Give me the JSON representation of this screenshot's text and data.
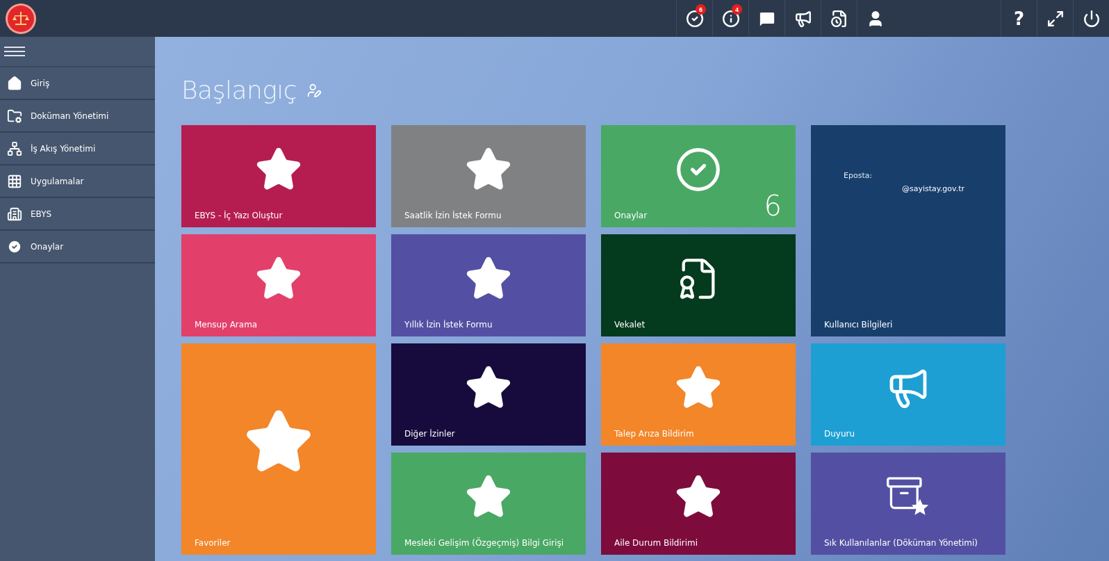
{
  "topbar": {
    "actions": [
      {
        "kind": "check",
        "badge": "6"
      },
      {
        "kind": "info",
        "badge": "4"
      },
      {
        "kind": "chat"
      },
      {
        "kind": "megaphone"
      },
      {
        "kind": "document"
      },
      {
        "kind": "user"
      }
    ],
    "help": "?",
    "tools": [
      {
        "kind": "expand"
      },
      {
        "kind": "power"
      }
    ]
  },
  "sidebar": {
    "items": [
      {
        "label": "Giriş",
        "kind": "home"
      },
      {
        "label": "Doküman Yönetimi",
        "kind": "folder"
      },
      {
        "label": "İş Akış Yönetimi",
        "kind": "workflow"
      },
      {
        "label": "Uygulamalar",
        "kind": "grid"
      },
      {
        "label": "EBYS",
        "kind": "building"
      },
      {
        "label": "Onaylar",
        "kind": "check"
      }
    ]
  },
  "page": {
    "title": "Başlangıç"
  },
  "tile_columns": [
    [
      {
        "label": "EBYS - İç Yazı Oluştur",
        "color": "#b51d51",
        "kind": "star",
        "tall": false
      },
      {
        "label": "Mensup Arama",
        "color": "#e2406a",
        "kind": "star",
        "tall": false
      },
      {
        "label": "Favoriler",
        "color": "#f28629",
        "kind": "star",
        "tall": true
      }
    ],
    [
      {
        "label": "Saatlik İzin İstek Formu",
        "color": "#7f8183",
        "kind": "star",
        "tall": false
      },
      {
        "label": "Yıllık İzin İstek Formu",
        "color": "#5350a3",
        "kind": "star",
        "tall": false
      },
      {
        "label": "Diğer İzinler",
        "color": "#170b3d",
        "kind": "star",
        "tall": false
      },
      {
        "label": "Mesleki Gelişim (Özgeçmiş) Bilgi Girişi",
        "color": "#4aa865",
        "kind": "star",
        "tall": false
      }
    ],
    [
      {
        "label": "Onaylar",
        "color": "#4aa865",
        "kind": "check",
        "tall": false,
        "count": "6"
      },
      {
        "label": "Vekalet",
        "color": "#043a1d",
        "kind": "certificate",
        "tall": false
      },
      {
        "label": "Talep Arıza Bildirim",
        "color": "#f28629",
        "kind": "star",
        "tall": false
      },
      {
        "label": "Aile Durum Bildirimi",
        "color": "#7d0c3d",
        "kind": "star",
        "tall": false
      }
    ],
    [
      {
        "label": "Kullanıcı Bilgileri",
        "color": "#183f6c",
        "kind": "info",
        "tall": true,
        "email_label": "Eposta:",
        "email": "@sayistay.gov.tr"
      },
      {
        "label": "Duyuru",
        "color": "#1d9fd3",
        "kind": "megaphone",
        "tall": false
      },
      {
        "label": "Sık Kullanılanlar (Döküman Yönetimi)",
        "color": "#5350a3",
        "kind": "box-star",
        "tall": false
      }
    ]
  ]
}
